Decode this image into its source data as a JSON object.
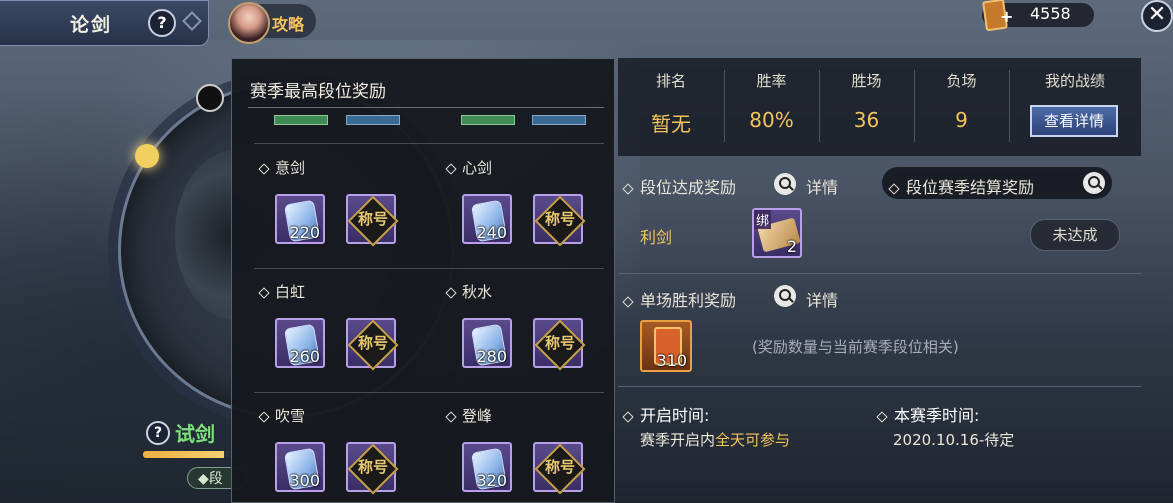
{
  "header": {
    "title": "论剑",
    "help": "?",
    "guide_label": "攻略",
    "currency_value": "4558",
    "close": "✕"
  },
  "left": {
    "trial_help": "?",
    "trial_label": "试剑",
    "progress": 0.85,
    "rank_tag": "段"
  },
  "popup": {
    "title": "赛季最高段位奖励",
    "tiers": [
      {
        "name": "意剑",
        "count": "220",
        "title_glyph": "称号"
      },
      {
        "name": "心剑",
        "count": "240",
        "title_glyph": "称号"
      },
      {
        "name": "白虹",
        "count": "260",
        "title_glyph": "称号"
      },
      {
        "name": "秋水",
        "count": "280",
        "title_glyph": "称号"
      },
      {
        "name": "吹雪",
        "count": "300",
        "title_glyph": "称号"
      },
      {
        "name": "登峰",
        "count": "320",
        "title_glyph": "称号"
      }
    ]
  },
  "stats": {
    "headers": [
      "排名",
      "胜率",
      "胜场",
      "负场",
      "我的战绩"
    ],
    "values": [
      "暂无",
      "80%",
      "36",
      "9"
    ],
    "detail_button": "查看详情"
  },
  "rank_reward": {
    "title": "段位达成奖励",
    "detail": "详情",
    "season_tab": "段位赛季结算奖励",
    "label": "利剑",
    "bind": "绑",
    "item_count": "2",
    "status": "未达成"
  },
  "win_reward": {
    "title": "单场胜利奖励",
    "detail": "详情",
    "item_count": "310",
    "note": "(奖励数量与当前赛季段位相关)"
  },
  "info": {
    "open_title": "开启时间:",
    "open_prefix": "赛季开启内",
    "open_highlight": "全天可参与",
    "season_title": "本赛季时间:",
    "season_value": "2020.10.16-待定"
  }
}
